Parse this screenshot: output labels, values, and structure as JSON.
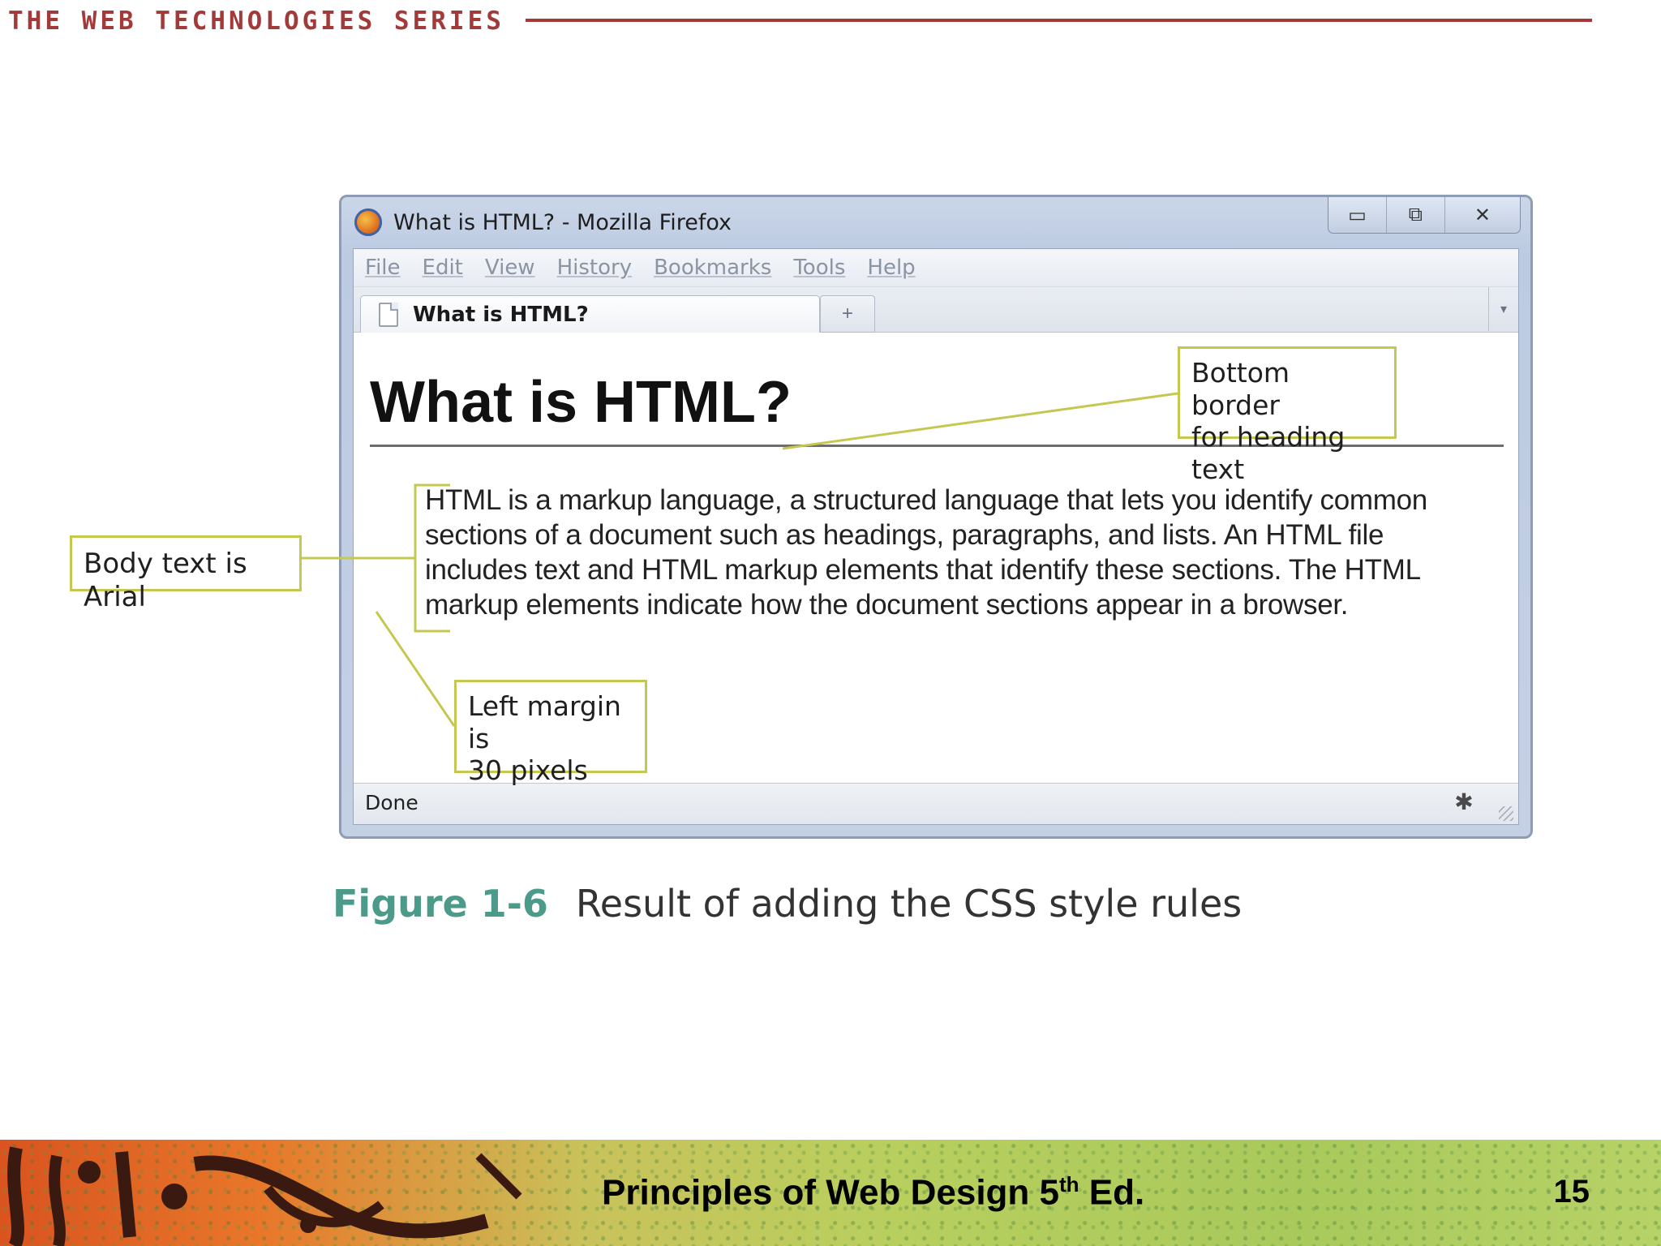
{
  "header": {
    "series_title": "THE WEB TECHNOLOGIES SERIES"
  },
  "browser": {
    "window_title": "What is HTML? - Mozilla Firefox",
    "controls": {
      "minimize": "▭",
      "restore": "⧉",
      "close": "✕"
    },
    "menu": [
      "File",
      "Edit",
      "View",
      "History",
      "Bookmarks",
      "Tools",
      "Help"
    ],
    "tab_label": "What is HTML?",
    "new_tab": "+",
    "tab_list": "▾",
    "page": {
      "heading": "What is HTML?",
      "paragraph_lines": [
        "HTML is a markup language, a structured language that lets you identify common",
        "sections of a document such as headings, paragraphs, and lists. An HTML file",
        "includes text and HTML markup elements that identify these sections. The HTML",
        "markup elements indicate how the document sections appear in a browser."
      ]
    },
    "status": "Done"
  },
  "callouts": {
    "bottom_border": [
      "Bottom border",
      "for heading text"
    ],
    "body_text": [
      "Body text is Arial"
    ],
    "left_margin": [
      "Left margin is",
      "30 pixels"
    ]
  },
  "figure": {
    "label": "Figure 1-6",
    "caption": "Result of adding the CSS style rules"
  },
  "footer": {
    "title_main": "Principles of Web Design 5",
    "title_sup": "th",
    "title_end": " Ed.",
    "page_number": "15"
  },
  "colors": {
    "series_red": "#a33a3a",
    "callout_border": "#c5c850",
    "figure_label": "#4b9a8a"
  }
}
